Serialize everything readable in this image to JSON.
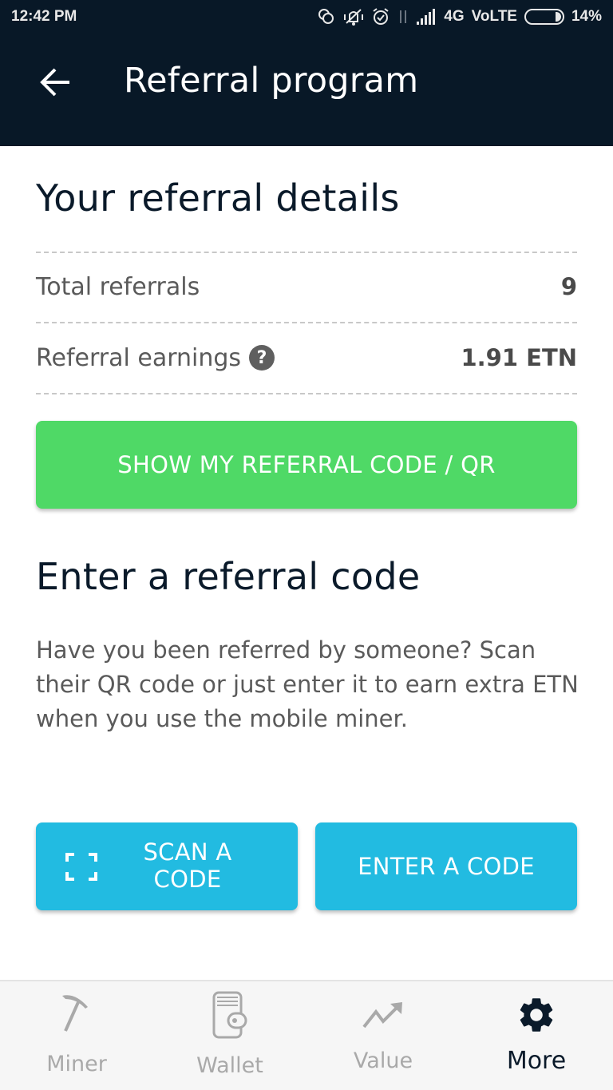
{
  "status_bar": {
    "time": "12:42 PM",
    "network": "4G",
    "volte": "VoLTE",
    "battery": "14%",
    "icons": [
      "sync-icon",
      "muted-vibrate-icon",
      "alarm-icon",
      "data-transfer-icon",
      "signal-icon",
      "battery-icon"
    ]
  },
  "app_bar": {
    "title": "Referral program",
    "back_icon": "arrow-left-icon"
  },
  "referral_details": {
    "heading": "Your referral details",
    "rows": [
      {
        "label": "Total referrals",
        "value": "9"
      },
      {
        "label": "Referral earnings",
        "value": "1.91 ETN",
        "help_icon": "question-circle-icon"
      }
    ],
    "show_code_button": "SHOW MY REFERRAL CODE / QR"
  },
  "enter_code": {
    "heading": "Enter a referral code",
    "description": "Have you been referred by someone? Scan their QR code or just enter it to earn extra ETN when you use the mobile miner.",
    "scan_button": {
      "label_line1": "SCAN A",
      "label_line2": "CODE",
      "icon": "scan-frame-icon"
    },
    "enter_button": "ENTER A CODE"
  },
  "bottom_nav": {
    "items": [
      {
        "label": "Miner",
        "icon": "pickaxe-icon",
        "active": false
      },
      {
        "label": "Wallet",
        "icon": "wallet-icon",
        "active": false
      },
      {
        "label": "Value",
        "icon": "trending-up-icon",
        "active": false
      },
      {
        "label": "More",
        "icon": "gear-icon",
        "active": true
      }
    ]
  },
  "colors": {
    "header_bg": "#081827",
    "primary_text": "#0a1a2a",
    "green_button": "#4fd966",
    "blue_button": "#22bbe1",
    "inactive_nav": "#a9a9a9"
  }
}
